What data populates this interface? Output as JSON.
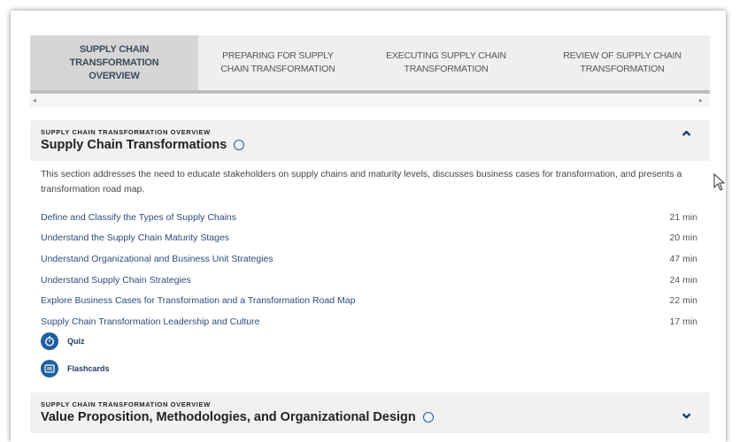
{
  "tabs": [
    {
      "label": "SUPPLY CHAIN TRANSFORMATION OVERVIEW",
      "active": true
    },
    {
      "label": "PREPARING FOR SUPPLY CHAIN TRANSFORMATION",
      "active": false
    },
    {
      "label": "EXECUTING SUPPLY CHAIN TRANSFORMATION",
      "active": false
    },
    {
      "label": "REVIEW OF SUPPLY CHAIN TRANSFORMATION",
      "active": false
    }
  ],
  "scroll": {
    "left_arrow": "◂",
    "right_arrow": "▸"
  },
  "section1": {
    "kicker": "SUPPLY CHAIN TRANSFORMATION OVERVIEW",
    "title": "Supply Chain Transformations",
    "chevron": "⌃",
    "description": "This section addresses the need to educate stakeholders on supply chains and maturity levels, discusses business cases for transformation, and presents a transformation road map.",
    "lessons": [
      {
        "title": "Define and Classify the Types of Supply Chains",
        "duration": "21 min"
      },
      {
        "title": "Understand the Supply Chain Maturity Stages",
        "duration": "20 min"
      },
      {
        "title": "Understand Organizational and Business Unit Strategies",
        "duration": "47 min"
      },
      {
        "title": "Understand Supply Chain Strategies",
        "duration": "24 min"
      },
      {
        "title": "Explore Business Cases for Transformation and a Transformation Road Map",
        "duration": "22 min"
      },
      {
        "title": "Supply Chain Transformation Leadership and Culture",
        "duration": "17 min"
      }
    ],
    "quiz_label": "Quiz",
    "quiz_icon": "stopwatch-icon",
    "flashcards_label": "Flashcards",
    "flashcards_icon": "flashcards-icon"
  },
  "section2": {
    "kicker": "SUPPLY CHAIN TRANSFORMATION OVERVIEW",
    "title": "Value Proposition, Methodologies, and Organizational Design",
    "chevron": "⌄"
  },
  "colors": {
    "accent": "#1f5f9e",
    "link": "#2a4d7a",
    "header_bg": "#f1f1f1",
    "active_tab": "#d6d6d6"
  }
}
